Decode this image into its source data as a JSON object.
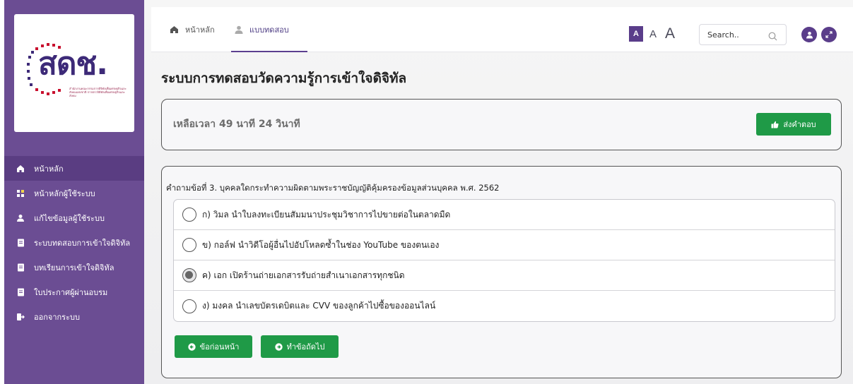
{
  "sidebar": {
    "logo": {
      "wordmark": "สดช.",
      "subtitle": "สำนักงานคณะกรรมการดิจิทัลเพื่อเศรษฐกิจและสังคมแห่งชาติ การตรวจิดิทัลเพื่อเศรษฐกิจและสังคม"
    },
    "items": [
      {
        "label": "หน้าหลัก",
        "icon": "home-icon",
        "active": true
      },
      {
        "label": "หน้าหลักผู้ใช้ระบบ",
        "icon": "grid-icon",
        "active": false
      },
      {
        "label": "แก้ไขข้อมูลผู้ใช้ระบบ",
        "icon": "user-icon",
        "active": false
      },
      {
        "label": "ระบบทดสอบการเข้าใจดิจิทัล",
        "icon": "document-icon",
        "active": false
      },
      {
        "label": "บทเรียนการเข้าใจดิจิทัล",
        "icon": "document-icon",
        "active": false
      },
      {
        "label": "ใบประกาศผู้ผ่านอบรม",
        "icon": "document-icon",
        "active": false
      },
      {
        "label": "ออกจากระบบ",
        "icon": "logout-icon",
        "active": false
      }
    ],
    "accent_color": "#6b4d93"
  },
  "topbar": {
    "tabs": [
      {
        "label": "หน้าหลัก",
        "icon": "home-icon"
      },
      {
        "label": "แบบทดสอบ",
        "icon": "user-icon"
      }
    ],
    "font_size_buttons": [
      "A",
      "A",
      "A"
    ],
    "search": {
      "placeholder": "Search..",
      "value": ""
    }
  },
  "page": {
    "title": "ระบบการทดสอบวัดความรู้การเข้าใจดิจิทัล",
    "timer": "เหลือเวลา 49 นาที 24 วินาที",
    "submit_label": "ส่งคำตอบ"
  },
  "question": {
    "text": "คำถามข้อที่ 3. บุคคลใดกระทำความผิดตามพระราชบัญญัติคุ้มครองข้อมูลส่วนบุคคล พ.ศ. 2562",
    "options": [
      {
        "label": "ก) วิมล นำใบลงทะเบียนสัมมนาประชุมวิชาการไปขายต่อในตลาดมืด",
        "selected": false
      },
      {
        "label": "ข) กอล์ฟ นำวิดีโอผู้อื่นไปอัปโหลดซ้ำในช่อง YouTube ของตนเอง",
        "selected": false
      },
      {
        "label": "ค) เอก เปิดร้านถ่ายเอกสารรับถ่ายสำเนาเอกสารทุกชนิด",
        "selected": true
      },
      {
        "label": "ง) มงคล นำเลขบัตรเดบิตและ CVV ของลูกค้าไปซื้อของออนไลน์",
        "selected": false
      }
    ],
    "prev_label": "ข้อก่อนหน้า",
    "next_label": "ทำข้อถัดไป"
  },
  "colors": {
    "primary_green": "#1f9a47",
    "purple": "#5a3d8a"
  }
}
